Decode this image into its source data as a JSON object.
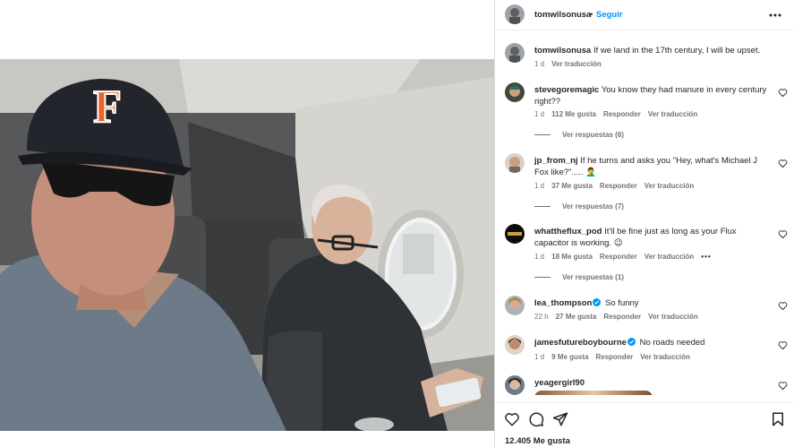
{
  "post": {
    "author": "tomwilsonusa",
    "separator": "•",
    "follow_label": "Seguir"
  },
  "caption": {
    "user": "tomwilsonusa",
    "text": "If we land in the 17th century, I will be upset.",
    "time": "1 d",
    "translate": "Ver traducción"
  },
  "comments": [
    {
      "user": "stevegoremagic",
      "verified": false,
      "text": "You know they had manure in every century right??",
      "time": "1 d",
      "likes": "112 Me gusta",
      "reply": "Responder",
      "translate": "Ver traducción",
      "replies": "Ver respuestas (6)"
    },
    {
      "user": "jp_from_nj",
      "verified": false,
      "text": "If he turns and asks you \"Hey, what's Michael J Fox like?\"..... 🤦‍♂️",
      "time": "1 d",
      "likes": "37 Me gusta",
      "reply": "Responder",
      "translate": "Ver traducción",
      "replies": "Ver respuestas (7)"
    },
    {
      "user": "whattheflux_pod",
      "verified": false,
      "text": "It'll be fine just as long as your Flux capacitor is working. 😉",
      "time": "1 d",
      "likes": "18 Me gusta",
      "reply": "Responder",
      "translate": "Ver traducción",
      "more": "•••",
      "replies": "Ver respuestas (1)"
    },
    {
      "user": "lea_thompson",
      "verified": true,
      "text": "So funny",
      "time": "22 h",
      "likes": "27 Me gusta",
      "reply": "Responder",
      "translate": "Ver traducción"
    },
    {
      "user": "jamesfutureboybourne",
      "verified": true,
      "text": "No roads needed",
      "time": "1 d",
      "likes": "9 Me gusta",
      "reply": "Responder",
      "translate": "Ver traducción"
    },
    {
      "user": "yeagergirl90",
      "verified": false,
      "text": ""
    }
  ],
  "footer": {
    "likes": "12.405 Me gusta"
  },
  "icons": {
    "more": "more-horizontal-icon",
    "like": "heart-icon",
    "comment": "comment-bubble-icon",
    "share": "paper-plane-icon",
    "save": "bookmark-icon",
    "verified": "verified-badge-icon"
  },
  "colors": {
    "accent": "#0095f6",
    "text": "#262626",
    "muted": "#737373",
    "verified": "#0095f6"
  },
  "photo": {
    "hat_letter": "F"
  }
}
